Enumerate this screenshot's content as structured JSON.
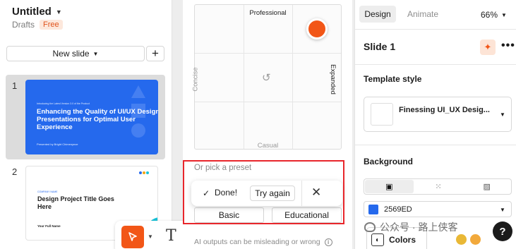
{
  "header": {
    "doc_title": "Untitled",
    "location": "Drafts",
    "plan_badge": "Free"
  },
  "slides_panel": {
    "new_slide_label": "New slide",
    "add_label": "+",
    "slides": [
      {
        "number": "1",
        "intro": "Introducing the Latest Version 3.0 of the Product",
        "title": "Enhancing the Quality of UI/UX Design Presentations for Optimal User Experience",
        "presenter": "Presented by Bright Chimenyeze"
      },
      {
        "number": "2",
        "tag": "COMPANY NAME",
        "title": "Design Project Title Goes Here",
        "name": "Your Full Name"
      }
    ]
  },
  "toolbar": {
    "text_tool_glyph": "T"
  },
  "ai_style": {
    "axis_top": "Professional",
    "axis_bottom": "Casual",
    "axis_left": "Concise",
    "axis_right": "Expanded",
    "reset_glyph": "↺",
    "preset_label": "Or pick a preset",
    "presets": [
      "Basic",
      "Educational"
    ],
    "done_label": "Done!",
    "try_again_label": "Try again",
    "close_glyph": "✕",
    "check_glyph": "✓",
    "disclaimer": "AI outputs can be misleading or wrong",
    "accent_color": "#f25617"
  },
  "right_panel": {
    "tab_design": "Design",
    "tab_animate": "Animate",
    "zoom": "66%",
    "slide_name": "Slide 1",
    "more_glyph": "•••",
    "template_section": "Template style",
    "template_name": "Finessing UI_UX Desig...",
    "background_section": "Background",
    "bg_color_hex": "2569ED",
    "bg_color": "#2569ed",
    "colors_label": "Colors"
  },
  "overlay": {
    "watermark": "公众号 · 路上侠客",
    "help": "?"
  }
}
